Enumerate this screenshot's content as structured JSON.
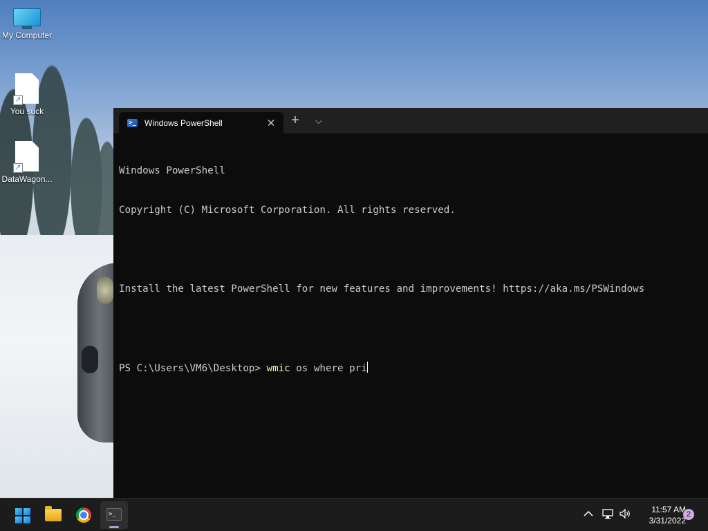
{
  "desktop": {
    "icons": [
      {
        "label": "My Computer",
        "icon": "monitor-icon"
      },
      {
        "label": "You suck",
        "icon": "file-shortcut-icon"
      },
      {
        "label": "DataWagon...",
        "icon": "file-shortcut-icon"
      }
    ]
  },
  "window": {
    "tab_title": "Windows PowerShell",
    "tab_icon": "powershell-icon",
    "terminal": {
      "lines": [
        "Windows PowerShell",
        "Copyright (C) Microsoft Corporation. All rights reserved.",
        "",
        "Install the latest PowerShell for new features and improvements! https://aka.ms/PSWindows",
        ""
      ],
      "prompt": "PS C:\\Users\\VM6\\Desktop> ",
      "command_keyword": "wmic",
      "command_args": " os where pri"
    }
  },
  "taskbar": {
    "apps": [
      "start-icon",
      "file-explorer-icon",
      "chrome-icon",
      "terminal-icon"
    ],
    "active_app": "terminal-icon",
    "clock_time": "11:57 AM",
    "clock_date": "3/31/2022",
    "notification_count": "2"
  },
  "colors": {
    "terminal_bg": "#0c0c0c",
    "terminal_fg": "#cccccc",
    "command_highlight": "#f9f1a5",
    "taskbar_bg": "#1c1c1c"
  }
}
